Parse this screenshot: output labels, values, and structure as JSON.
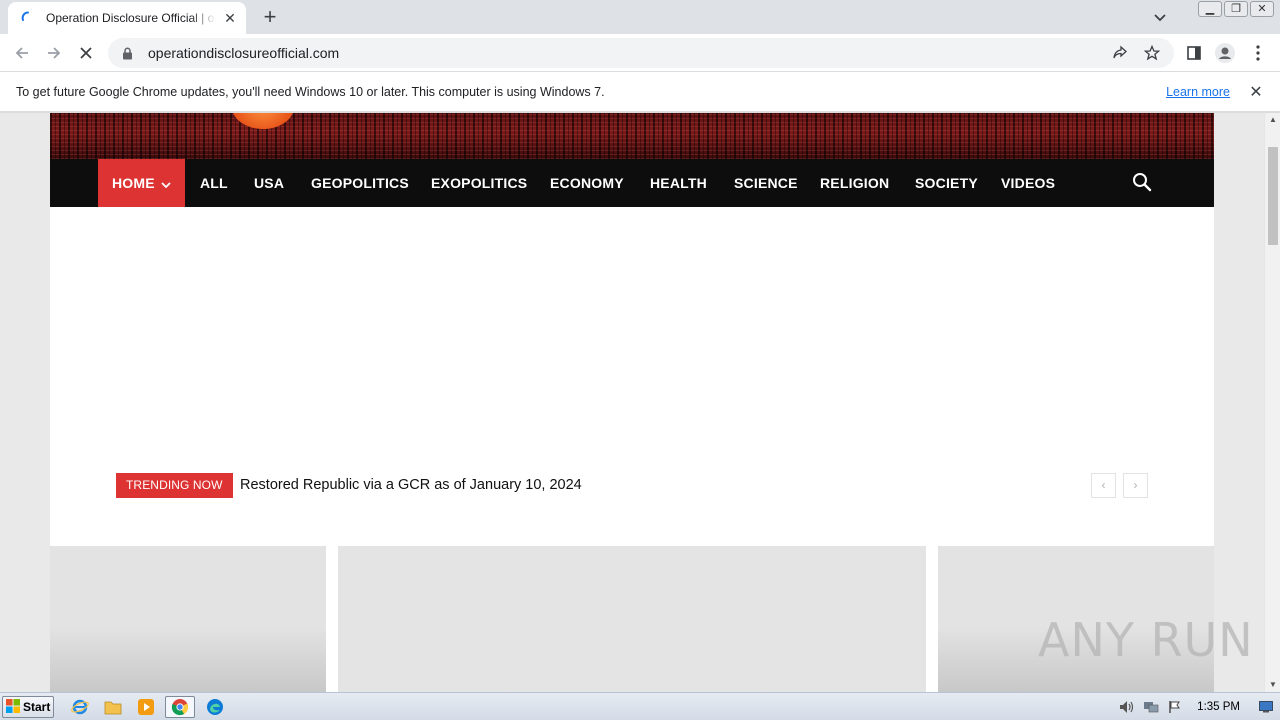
{
  "browser": {
    "tab_title": "Operation Disclosure Official | operationdisclosureofficial.com",
    "new_tab_label": "+",
    "url": "operationdisclosureofficial.com",
    "infobar_message": "To get future Google Chrome updates, you'll need Windows 10 or later. This computer is using Windows 7.",
    "infobar_link": "Learn more"
  },
  "site": {
    "nav_items": [
      "HOME",
      "ALL",
      "USA",
      "GEOPOLITICS",
      "EXOPOLITICS",
      "ECONOMY",
      "HEALTH",
      "SCIENCE",
      "RELIGION",
      "SOCIETY",
      "VIDEOS"
    ],
    "trending_badge": "TRENDING NOW",
    "trending_title": "Restored Republic via a GCR as of January 10, 2024",
    "prev_label": "‹",
    "next_label": "›",
    "accent": "#dd3333"
  },
  "watermark": "ANY RUN",
  "taskbar": {
    "start_label": "Start",
    "clock": "1:35 PM"
  }
}
